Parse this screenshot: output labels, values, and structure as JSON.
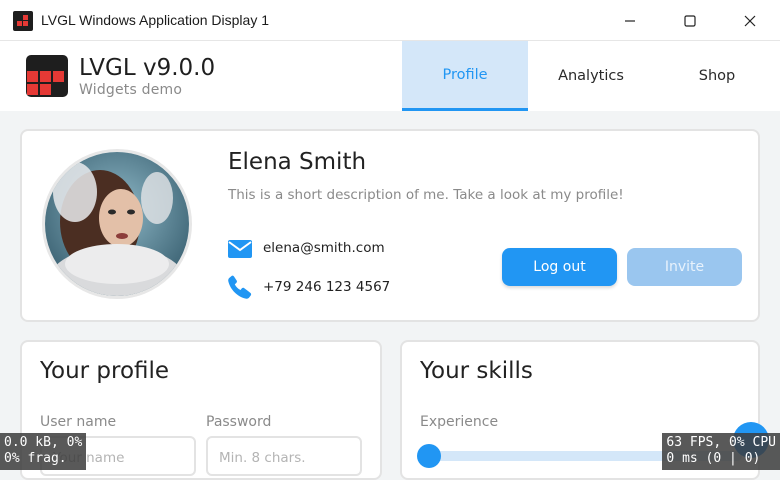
{
  "window": {
    "title": "LVGL Windows Application Display 1",
    "controls": {
      "minimize": "minimize-icon",
      "maximize": "maximize-icon",
      "close": "close-icon"
    }
  },
  "header": {
    "title": "LVGL v9.0.0",
    "subtitle": "Widgets demo",
    "tabs": [
      {
        "label": "Profile",
        "active": true
      },
      {
        "label": "Analytics",
        "active": false
      },
      {
        "label": "Shop",
        "active": false
      }
    ]
  },
  "profile": {
    "name": "Elena Smith",
    "description": "This is a short description of me. Take a look at my profile!",
    "email": "elena@smith.com",
    "phone": "+79 246 123 4567",
    "logout_label": "Log out",
    "invite_label": "Invite"
  },
  "your_profile": {
    "title": "Your profile",
    "username_label": "User name",
    "username_placeholder": "Your name",
    "password_label": "Password",
    "password_placeholder": "Min. 8 chars."
  },
  "your_skills": {
    "title": "Your skills",
    "experience_label": "Experience",
    "experience_value": 0
  },
  "perf": {
    "memory": "0.0 kB, 0%\n0% frag.",
    "fps": "63 FPS, 0% CPU\n0 ms (0 | 0)"
  },
  "colors": {
    "accent": "#2196f3",
    "tab_active_bg": "#d4e7f9",
    "invite_disabled": "#9ac6ef",
    "logo_red": "#e53935",
    "logo_dark": "#1e1e1e"
  }
}
